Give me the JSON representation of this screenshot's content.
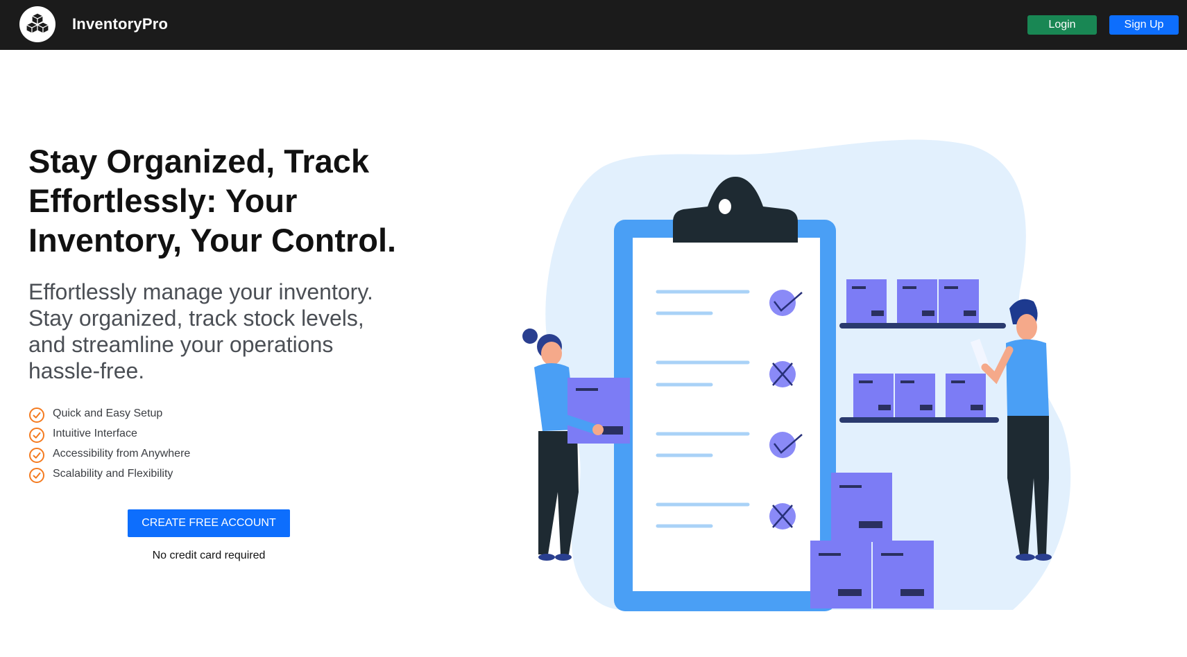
{
  "navbar": {
    "brand_name": "InventoryPro",
    "brand_icon": "cubes-icon",
    "login_label": "Login",
    "signup_label": "Sign Up"
  },
  "hero": {
    "title": "Stay Organized, Track Effortlessly: Your Inventory, Your Control.",
    "subtitle": "Effortlessly manage your inventory. Stay organized, track stock levels, and streamline your operations hassle-free.",
    "features": [
      "Quick and Easy Setup",
      "Intuitive Interface",
      "Accessibility from Anywhere",
      "Scalability and Flexibility"
    ],
    "feature_icon": "check-circle-icon",
    "cta_label": "CREATE FREE ACCOUNT",
    "cta_note": "No credit card required"
  },
  "colors": {
    "navbar_bg": "#1b1b1b",
    "login_button": "#198754",
    "signup_button": "#0d6efd",
    "cta_button": "#0d6efd",
    "check_accent": "#f47b20",
    "illustration_blue": "#4a9ff5",
    "illustration_purple": "#7c7cf5",
    "illustration_bg": "#e2f0fd"
  }
}
